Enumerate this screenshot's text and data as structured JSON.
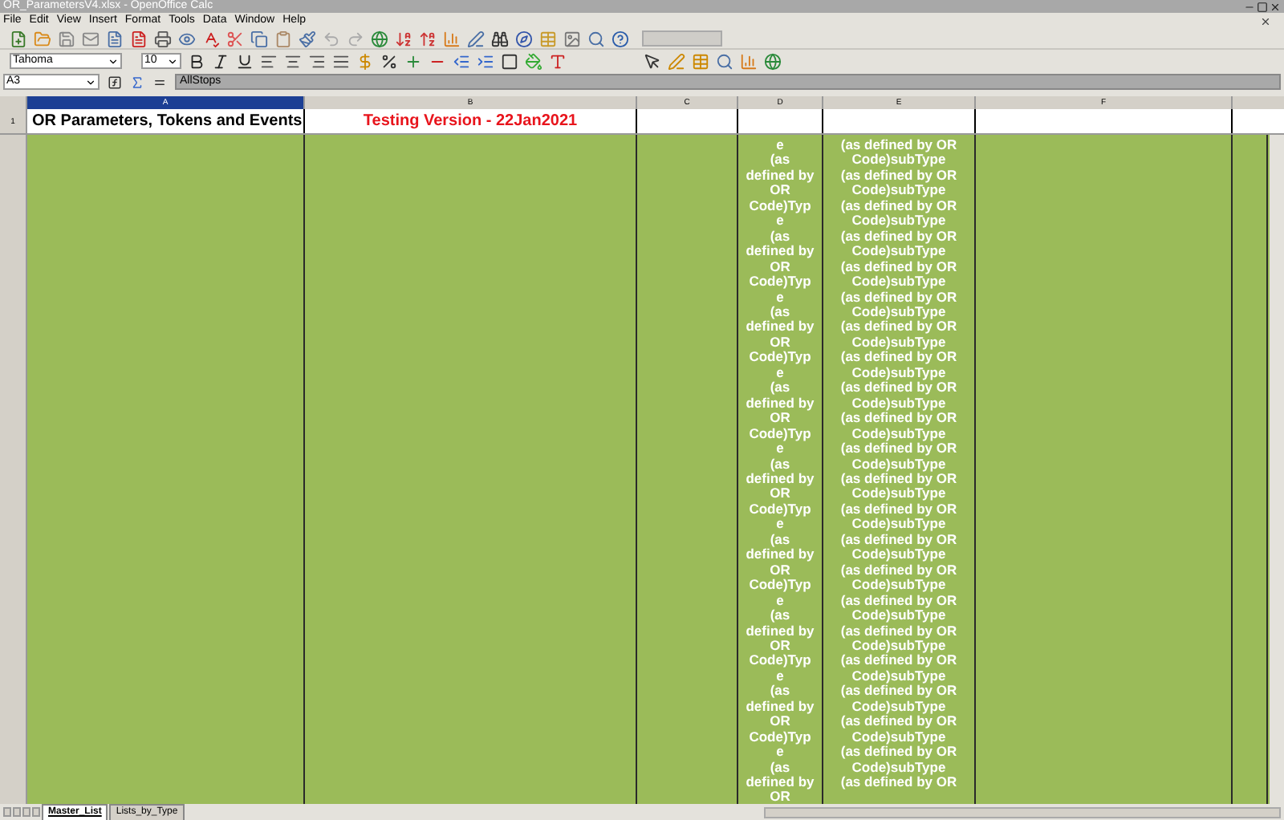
{
  "window": {
    "title": "OR_ParametersV4.xlsx - OpenOffice Calc"
  },
  "menu": [
    "File",
    "Edit",
    "View",
    "Insert",
    "Format",
    "Tools",
    "Data",
    "Window",
    "Help"
  ],
  "format_bar": {
    "font_name": "Tahoma",
    "font_size": "10"
  },
  "formula_bar": {
    "cell_ref": "A3",
    "formula": "AllStops"
  },
  "columns": [
    {
      "label": "A",
      "selected": true
    },
    {
      "label": "B",
      "selected": false
    },
    {
      "label": "C",
      "selected": false
    },
    {
      "label": "D",
      "selected": false
    },
    {
      "label": "E",
      "selected": false
    },
    {
      "label": "F",
      "selected": false
    }
  ],
  "rows": [
    {
      "number": "1",
      "cells": [
        "OR Parameters, Tokens and Events",
        "Testing Version - 22Jan2021",
        "",
        "",
        "",
        ""
      ]
    }
  ],
  "green_row": {
    "column_D_lines": [
      "e",
      "(as",
      "defined by",
      "OR",
      "Code)Typ",
      "e",
      "(as",
      "defined by",
      "OR",
      "Code)Typ",
      "e",
      "(as",
      "defined by",
      "OR",
      "Code)Typ",
      "e",
      "(as",
      "defined by",
      "OR",
      "Code)Typ",
      "e",
      "(as",
      "defined by",
      "OR",
      "Code)Typ",
      "e",
      "(as",
      "defined by",
      "OR",
      "Code)Typ",
      "e",
      "(as",
      "defined by",
      "OR",
      "Code)Typ",
      "e",
      "(as",
      "defined by",
      "OR",
      "Code)Typ",
      "e",
      "(as",
      "defined by",
      "OR"
    ],
    "column_E_lines": [
      "(as defined by OR",
      "Code)subType",
      "(as defined by OR",
      "Code)subType",
      "(as defined by OR",
      "Code)subType",
      "(as defined by OR",
      "Code)subType",
      "(as defined by OR",
      "Code)subType",
      "(as defined by OR",
      "Code)subType",
      "(as defined by OR",
      "Code)subType",
      "(as defined by OR",
      "Code)subType",
      "(as defined by OR",
      "Code)subType",
      "(as defined by OR",
      "Code)subType",
      "(as defined by OR",
      "Code)subType",
      "(as defined by OR",
      "Code)subType",
      "(as defined by OR",
      "Code)subType",
      "(as defined by OR",
      "Code)subType",
      "(as defined by OR",
      "Code)subType",
      "(as defined by OR",
      "Code)subType",
      "(as defined by OR",
      "Code)subType",
      "(as defined by OR",
      "Code)subType",
      "(as defined by OR",
      "Code)subType",
      "(as defined by OR",
      "Code)subType",
      "(as defined by OR",
      "Code)subType",
      "(as defined by OR"
    ]
  },
  "sheet_tabs": [
    {
      "label": "Master_List",
      "selected": true
    },
    {
      "label": "Lists_by_Type",
      "selected": false
    }
  ]
}
